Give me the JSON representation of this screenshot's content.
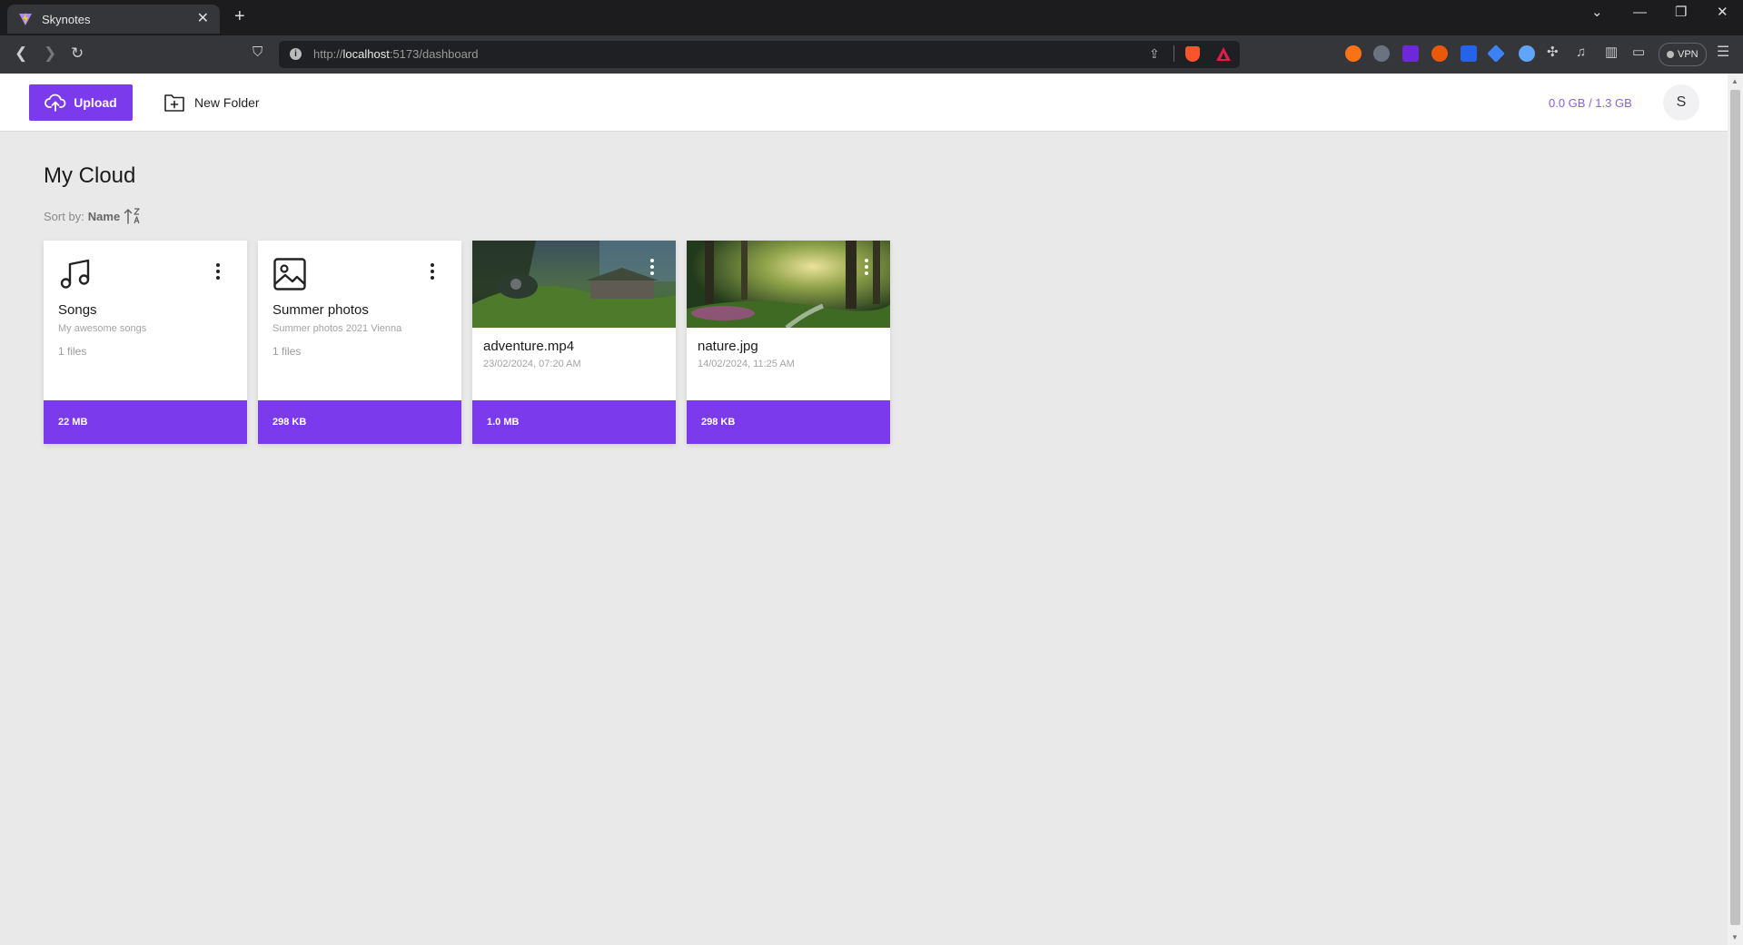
{
  "browser": {
    "tab_title": "Skynotes",
    "url_scheme": "http://",
    "url_host": "localhost",
    "url_rest": ":5173/dashboard",
    "vpn_label": "VPN"
  },
  "header": {
    "upload_label": "Upload",
    "new_folder_label": "New Folder",
    "storage": "0.0 GB / 1.3 GB",
    "avatar_initial": "S"
  },
  "main": {
    "title": "My Cloud",
    "sort_label": "Sort by:",
    "sort_value": "Name"
  },
  "items": [
    {
      "type": "folder",
      "icon": "music-note-icon",
      "name": "Songs",
      "description": "My awesome songs",
      "count": "1 files",
      "size": "22 MB"
    },
    {
      "type": "folder",
      "icon": "image-icon",
      "name": "Summer photos",
      "description": "Summer photos 2021 Vienna",
      "count": "1 files",
      "size": "298 KB"
    },
    {
      "type": "file",
      "thumbnail": "forest-hut-thumbnail",
      "name": "adventure.mp4",
      "date": "23/02/2024, 07:20 AM",
      "size": "1.0 MB"
    },
    {
      "type": "file",
      "thumbnail": "forest-stream-thumbnail",
      "name": "nature.jpg",
      "date": "14/02/2024, 11:25 AM",
      "size": "298 KB"
    }
  ],
  "colors": {
    "accent": "#7c3aed",
    "storage_text": "#8b5cf6"
  }
}
